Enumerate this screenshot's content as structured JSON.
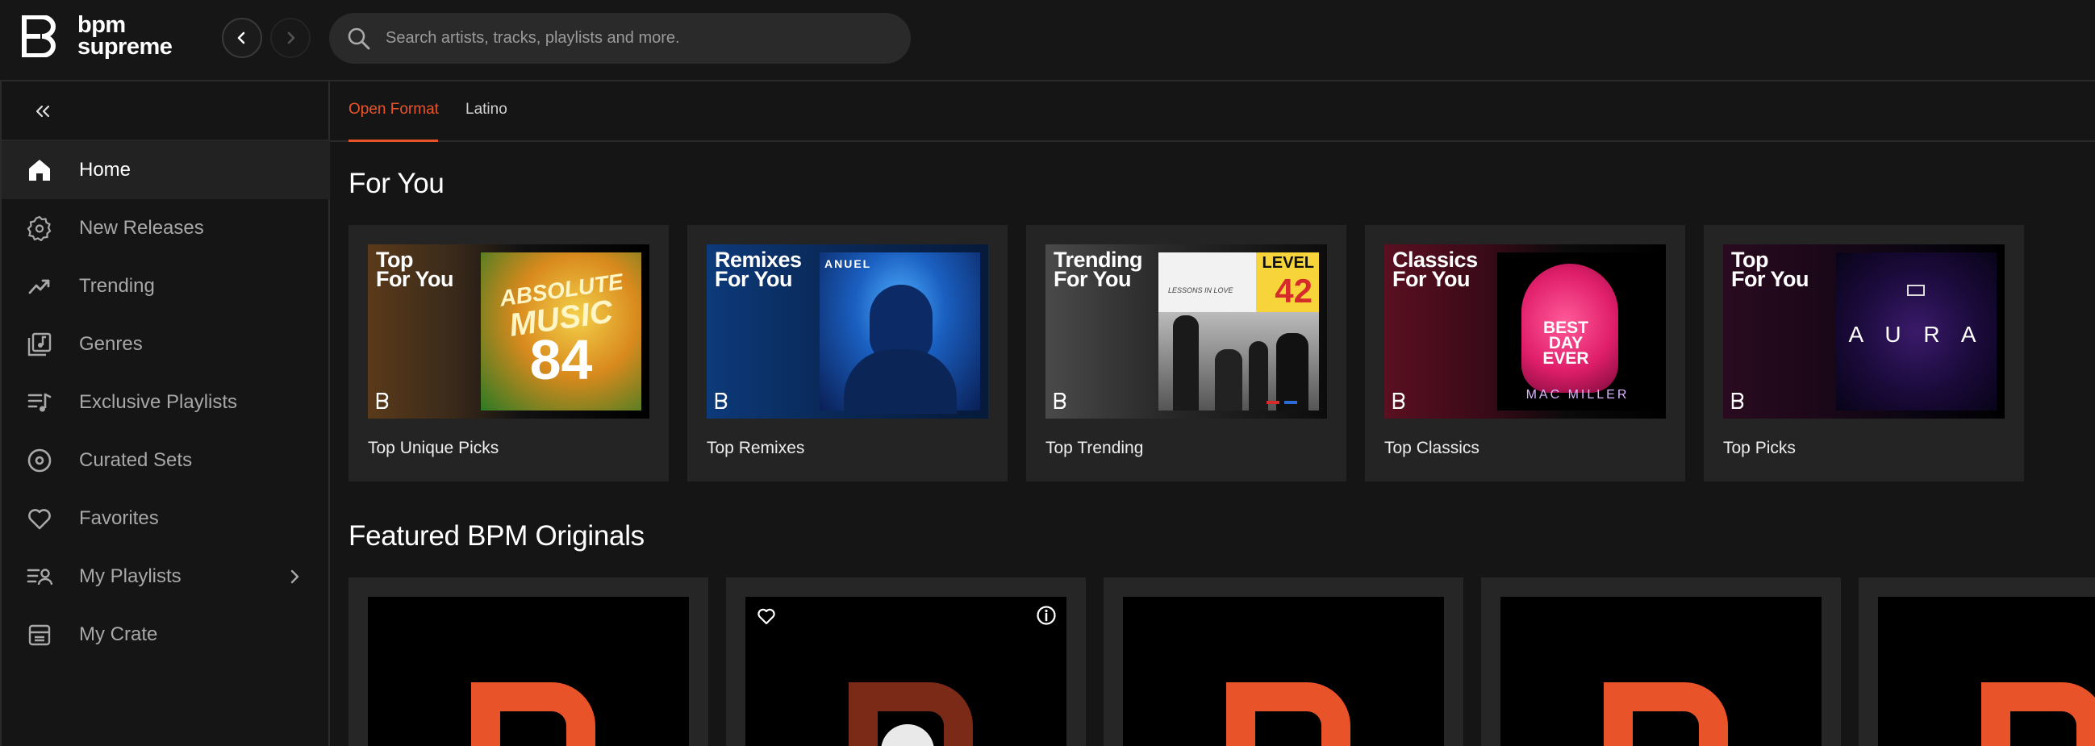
{
  "app": {
    "logo_line1": "bpm",
    "logo_line2": "supreme"
  },
  "search": {
    "placeholder": "Search artists, tracks, playlists and more."
  },
  "sidebar": {
    "items": [
      {
        "label": "Home",
        "icon": "home-icon",
        "active": true
      },
      {
        "label": "New Releases",
        "icon": "new-releases-icon"
      },
      {
        "label": "Trending",
        "icon": "trending-icon"
      },
      {
        "label": "Genres",
        "icon": "genres-icon"
      },
      {
        "label": "Exclusive Playlists",
        "icon": "exclusive-playlists-icon"
      },
      {
        "label": "Curated Sets",
        "icon": "curated-sets-icon"
      },
      {
        "label": "Favorites",
        "icon": "heart-icon"
      },
      {
        "label": "My Playlists",
        "icon": "my-playlists-icon",
        "has_submenu": true
      },
      {
        "label": "My Crate",
        "icon": "crate-icon"
      }
    ]
  },
  "tabs": [
    {
      "label": "Open Format",
      "active": true
    },
    {
      "label": "Latino"
    }
  ],
  "for_you": {
    "title": "For You",
    "cards": [
      {
        "art_line1": "Top",
        "art_line2": "For You",
        "label": "Top Unique Picks",
        "cover_word1": "ABSOLUTE",
        "cover_word2": "MUSIC",
        "cover_number": "84"
      },
      {
        "art_line1": "Remixes",
        "art_line2": "For You",
        "label": "Top Remixes",
        "cover_word1": "ANUEL"
      },
      {
        "art_line1": "Trending",
        "art_line2": "For You",
        "label": "Top Trending",
        "cover_word1": "LEVEL",
        "cover_number": "42",
        "cover_sub": "LESSONS IN LOVE"
      },
      {
        "art_line1": "Classics",
        "art_line2": "For You",
        "label": "Top Classics",
        "cover_word1": "BEST DAY EVER",
        "cover_sub": "MAC MILLER"
      },
      {
        "art_line1": "Top",
        "art_line2": "For You",
        "label": "Top Picks",
        "cover_word1": "A U R A"
      }
    ]
  },
  "originals": {
    "title": "Featured BPM Originals",
    "count": 5
  },
  "colors": {
    "accent": "#e8532a",
    "background": "#151515",
    "card": "#242424"
  }
}
